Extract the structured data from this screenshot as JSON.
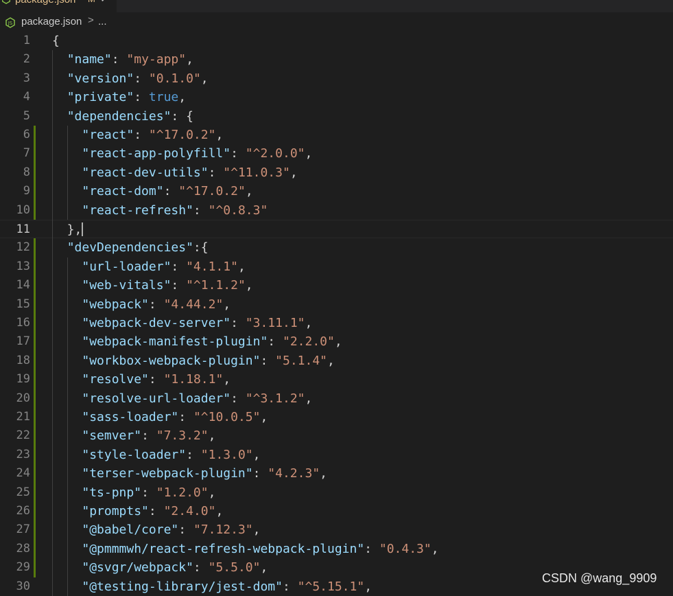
{
  "tab": {
    "label": "package.json",
    "status": "M",
    "close": "✓"
  },
  "breadcrumb": {
    "file": "package.json",
    "separator": ">",
    "more": "..."
  },
  "editor": {
    "active_line": 11,
    "lines": [
      {
        "n": "1",
        "parts": [
          {
            "t": "p",
            "v": "{"
          }
        ]
      },
      {
        "n": "2",
        "parts": [
          {
            "t": "p",
            "v": "  "
          },
          {
            "t": "k",
            "v": "\"name\""
          },
          {
            "t": "p",
            "v": ": "
          },
          {
            "t": "s",
            "v": "\"my-app\""
          },
          {
            "t": "p",
            "v": ","
          }
        ]
      },
      {
        "n": "3",
        "parts": [
          {
            "t": "p",
            "v": "  "
          },
          {
            "t": "k",
            "v": "\"version\""
          },
          {
            "t": "p",
            "v": ": "
          },
          {
            "t": "s",
            "v": "\"0.1.0\""
          },
          {
            "t": "p",
            "v": ","
          }
        ]
      },
      {
        "n": "4",
        "parts": [
          {
            "t": "p",
            "v": "  "
          },
          {
            "t": "k",
            "v": "\"private\""
          },
          {
            "t": "p",
            "v": ": "
          },
          {
            "t": "b",
            "v": "true"
          },
          {
            "t": "p",
            "v": ","
          }
        ]
      },
      {
        "n": "5",
        "parts": [
          {
            "t": "p",
            "v": "  "
          },
          {
            "t": "k",
            "v": "\"dependencies\""
          },
          {
            "t": "p",
            "v": ": {"
          }
        ]
      },
      {
        "n": "6",
        "parts": [
          {
            "t": "p",
            "v": "    "
          },
          {
            "t": "k",
            "v": "\"react\""
          },
          {
            "t": "p",
            "v": ": "
          },
          {
            "t": "s",
            "v": "\"^17.0.2\""
          },
          {
            "t": "p",
            "v": ","
          }
        ]
      },
      {
        "n": "7",
        "parts": [
          {
            "t": "p",
            "v": "    "
          },
          {
            "t": "k",
            "v": "\"react-app-polyfill\""
          },
          {
            "t": "p",
            "v": ": "
          },
          {
            "t": "s",
            "v": "\"^2.0.0\""
          },
          {
            "t": "p",
            "v": ","
          }
        ]
      },
      {
        "n": "8",
        "parts": [
          {
            "t": "p",
            "v": "    "
          },
          {
            "t": "k",
            "v": "\"react-dev-utils\""
          },
          {
            "t": "p",
            "v": ": "
          },
          {
            "t": "s",
            "v": "\"^11.0.3\""
          },
          {
            "t": "p",
            "v": ","
          }
        ]
      },
      {
        "n": "9",
        "parts": [
          {
            "t": "p",
            "v": "    "
          },
          {
            "t": "k",
            "v": "\"react-dom\""
          },
          {
            "t": "p",
            "v": ": "
          },
          {
            "t": "s",
            "v": "\"^17.0.2\""
          },
          {
            "t": "p",
            "v": ","
          }
        ]
      },
      {
        "n": "10",
        "parts": [
          {
            "t": "p",
            "v": "    "
          },
          {
            "t": "k",
            "v": "\"react-refresh\""
          },
          {
            "t": "p",
            "v": ": "
          },
          {
            "t": "s",
            "v": "\"^0.8.3\""
          }
        ]
      },
      {
        "n": "11",
        "parts": [
          {
            "t": "p",
            "v": "  },"
          }
        ]
      },
      {
        "n": "12",
        "parts": [
          {
            "t": "p",
            "v": "  "
          },
          {
            "t": "k",
            "v": "\"devDependencies\""
          },
          {
            "t": "p",
            "v": ":{"
          }
        ]
      },
      {
        "n": "13",
        "parts": [
          {
            "t": "p",
            "v": "    "
          },
          {
            "t": "k",
            "v": "\"url-loader\""
          },
          {
            "t": "p",
            "v": ": "
          },
          {
            "t": "s",
            "v": "\"4.1.1\""
          },
          {
            "t": "p",
            "v": ","
          }
        ]
      },
      {
        "n": "14",
        "parts": [
          {
            "t": "p",
            "v": "    "
          },
          {
            "t": "k",
            "v": "\"web-vitals\""
          },
          {
            "t": "p",
            "v": ": "
          },
          {
            "t": "s",
            "v": "\"^1.1.2\""
          },
          {
            "t": "p",
            "v": ","
          }
        ]
      },
      {
        "n": "15",
        "parts": [
          {
            "t": "p",
            "v": "    "
          },
          {
            "t": "k",
            "v": "\"webpack\""
          },
          {
            "t": "p",
            "v": ": "
          },
          {
            "t": "s",
            "v": "\"4.44.2\""
          },
          {
            "t": "p",
            "v": ","
          }
        ]
      },
      {
        "n": "16",
        "parts": [
          {
            "t": "p",
            "v": "    "
          },
          {
            "t": "k",
            "v": "\"webpack-dev-server\""
          },
          {
            "t": "p",
            "v": ": "
          },
          {
            "t": "s",
            "v": "\"3.11.1\""
          },
          {
            "t": "p",
            "v": ","
          }
        ]
      },
      {
        "n": "17",
        "parts": [
          {
            "t": "p",
            "v": "    "
          },
          {
            "t": "k",
            "v": "\"webpack-manifest-plugin\""
          },
          {
            "t": "p",
            "v": ": "
          },
          {
            "t": "s",
            "v": "\"2.2.0\""
          },
          {
            "t": "p",
            "v": ","
          }
        ]
      },
      {
        "n": "18",
        "parts": [
          {
            "t": "p",
            "v": "    "
          },
          {
            "t": "k",
            "v": "\"workbox-webpack-plugin\""
          },
          {
            "t": "p",
            "v": ": "
          },
          {
            "t": "s",
            "v": "\"5.1.4\""
          },
          {
            "t": "p",
            "v": ","
          }
        ]
      },
      {
        "n": "19",
        "parts": [
          {
            "t": "p",
            "v": "    "
          },
          {
            "t": "k",
            "v": "\"resolve\""
          },
          {
            "t": "p",
            "v": ": "
          },
          {
            "t": "s",
            "v": "\"1.18.1\""
          },
          {
            "t": "p",
            "v": ","
          }
        ]
      },
      {
        "n": "20",
        "parts": [
          {
            "t": "p",
            "v": "    "
          },
          {
            "t": "k",
            "v": "\"resolve-url-loader\""
          },
          {
            "t": "p",
            "v": ": "
          },
          {
            "t": "s",
            "v": "\"^3.1.2\""
          },
          {
            "t": "p",
            "v": ","
          }
        ]
      },
      {
        "n": "21",
        "parts": [
          {
            "t": "p",
            "v": "    "
          },
          {
            "t": "k",
            "v": "\"sass-loader\""
          },
          {
            "t": "p",
            "v": ": "
          },
          {
            "t": "s",
            "v": "\"^10.0.5\""
          },
          {
            "t": "p",
            "v": ","
          }
        ]
      },
      {
        "n": "22",
        "parts": [
          {
            "t": "p",
            "v": "    "
          },
          {
            "t": "k",
            "v": "\"semver\""
          },
          {
            "t": "p",
            "v": ": "
          },
          {
            "t": "s",
            "v": "\"7.3.2\""
          },
          {
            "t": "p",
            "v": ","
          }
        ]
      },
      {
        "n": "23",
        "parts": [
          {
            "t": "p",
            "v": "    "
          },
          {
            "t": "k",
            "v": "\"style-loader\""
          },
          {
            "t": "p",
            "v": ": "
          },
          {
            "t": "s",
            "v": "\"1.3.0\""
          },
          {
            "t": "p",
            "v": ","
          }
        ]
      },
      {
        "n": "24",
        "parts": [
          {
            "t": "p",
            "v": "    "
          },
          {
            "t": "k",
            "v": "\"terser-webpack-plugin\""
          },
          {
            "t": "p",
            "v": ": "
          },
          {
            "t": "s",
            "v": "\"4.2.3\""
          },
          {
            "t": "p",
            "v": ","
          }
        ]
      },
      {
        "n": "25",
        "parts": [
          {
            "t": "p",
            "v": "    "
          },
          {
            "t": "k",
            "v": "\"ts-pnp\""
          },
          {
            "t": "p",
            "v": ": "
          },
          {
            "t": "s",
            "v": "\"1.2.0\""
          },
          {
            "t": "p",
            "v": ","
          }
        ]
      },
      {
        "n": "26",
        "parts": [
          {
            "t": "p",
            "v": "    "
          },
          {
            "t": "k",
            "v": "\"prompts\""
          },
          {
            "t": "p",
            "v": ": "
          },
          {
            "t": "s",
            "v": "\"2.4.0\""
          },
          {
            "t": "p",
            "v": ","
          }
        ]
      },
      {
        "n": "27",
        "parts": [
          {
            "t": "p",
            "v": "    "
          },
          {
            "t": "k",
            "v": "\"@babel/core\""
          },
          {
            "t": "p",
            "v": ": "
          },
          {
            "t": "s",
            "v": "\"7.12.3\""
          },
          {
            "t": "p",
            "v": ","
          }
        ]
      },
      {
        "n": "28",
        "parts": [
          {
            "t": "p",
            "v": "    "
          },
          {
            "t": "k",
            "v": "\"@pmmmwh/react-refresh-webpack-plugin\""
          },
          {
            "t": "p",
            "v": ": "
          },
          {
            "t": "s",
            "v": "\"0.4.3\""
          },
          {
            "t": "p",
            "v": ","
          }
        ]
      },
      {
        "n": "29",
        "parts": [
          {
            "t": "p",
            "v": "    "
          },
          {
            "t": "k",
            "v": "\"@svgr/webpack\""
          },
          {
            "t": "p",
            "v": ": "
          },
          {
            "t": "s",
            "v": "\"5.5.0\""
          },
          {
            "t": "p",
            "v": ","
          }
        ]
      },
      {
        "n": "30",
        "parts": [
          {
            "t": "p",
            "v": "    "
          },
          {
            "t": "k",
            "v": "\"@testing-library/jest-dom\""
          },
          {
            "t": "p",
            "v": ": "
          },
          {
            "t": "s",
            "v": "\"^5.15.1\""
          },
          {
            "t": "p",
            "v": ","
          }
        ]
      }
    ]
  },
  "watermark": "CSDN @wang_9909",
  "colors": {
    "background": "#1e1e1e",
    "key": "#9cdcfe",
    "string": "#ce9178",
    "boolean": "#569cd6",
    "line_number": "#858585",
    "modified_gutter": "#587c0c"
  }
}
